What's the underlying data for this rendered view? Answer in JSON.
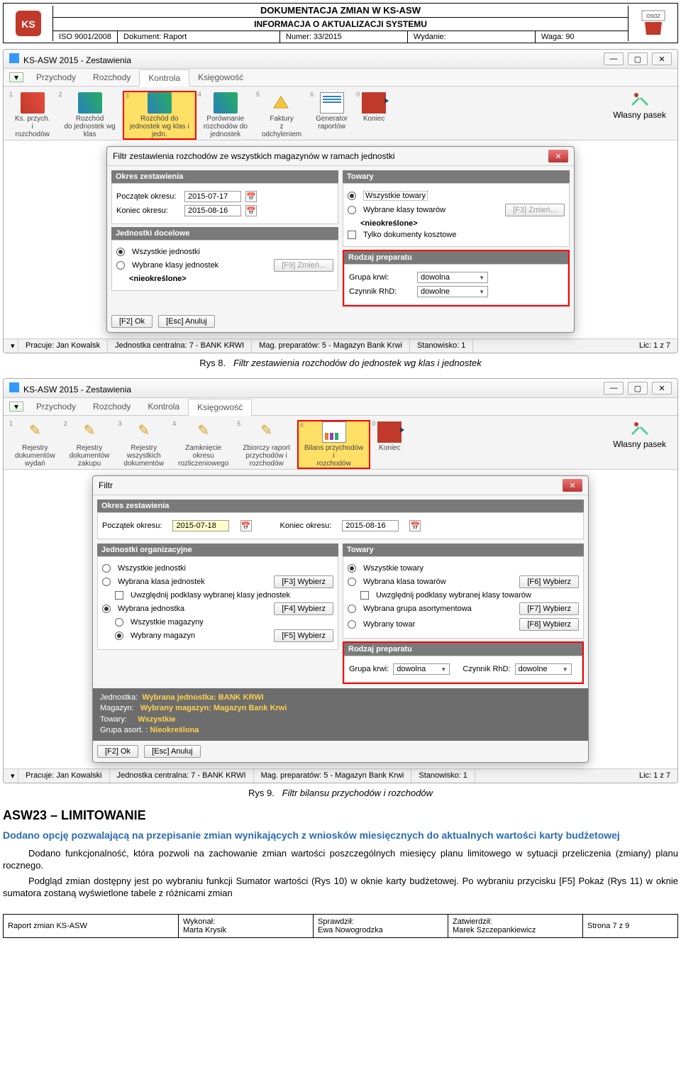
{
  "header": {
    "title": "DOKUMENTACJA ZMIAN W KS-ASW",
    "subtitle": "INFORMACJA O AKTUALIZACJI SYSTEMU",
    "iso": "ISO 9001/2008",
    "doc_label": "Dokument: Raport",
    "number": "Numer: 33/2015",
    "edition": "Wydanie:",
    "weight": "Waga: 90"
  },
  "shot1": {
    "title": "KS-ASW 2015 - Zestawienia",
    "tabs": [
      "Przychody",
      "Rozchody",
      "Kontrola",
      "Księgowość"
    ],
    "active_tab": 2,
    "ribbon": [
      {
        "n": "1",
        "label": "Ks. przych.\ni\nrozchodów"
      },
      {
        "n": "2",
        "label": "Rozchód\ndo jednostek wg\nklas"
      },
      {
        "n": "3",
        "label": "Rozchód do\njednostek wg klas i\njedn."
      },
      {
        "n": "4",
        "label": "Porównanie\nrozchodów do\njednostek"
      },
      {
        "n": "5",
        "label": "Faktury\nz\nodchyleniem"
      },
      {
        "n": "6",
        "label": "Generator\nraportów"
      },
      {
        "n": "0",
        "label": "Koniec"
      }
    ],
    "ribbon_right": "Własny pasek",
    "dialog_title": "Filtr zestawienia rozchodów ze wszystkich magazynów w ramach jednostki",
    "okres_hdr": "Okres zestawienia",
    "poczatek_lbl": "Początek okresu:",
    "poczatek_val": "2015-07-17",
    "koniec_lbl": "Koniec okresu:",
    "koniec_val": "2015-08-16",
    "jednostki_hdr": "Jednostki docelowe",
    "jedn_opt1": "Wszystkie jednostki",
    "jedn_opt2": "Wybrane klasy jednostek",
    "jedn_change": "[F9] Zmień...",
    "nieokreslone": "<nieokreślone>",
    "towary_hdr": "Towary",
    "tow_opt1": "Wszystkie towary",
    "tow_opt2": "Wybrane klasy towarów",
    "tow_change": "[F3] Zmień...",
    "tow_chk": "Tylko dokumenty kosztowe",
    "rodzaj_hdr": "Rodzaj preparatu",
    "grupa_lbl": "Grupa krwi:",
    "grupa_val": "dowolna",
    "czynnik_lbl": "Czynnik RhD:",
    "czynnik_val": "dowolne",
    "ok_btn": "[F2] Ok",
    "cancel_btn": "[Esc] Anuluj",
    "status": {
      "pracuje": "Pracuje: Jan Kowalsk",
      "jednostka": "Jednostka centralna: 7 - BANK KRWI",
      "mag": "Mag. preparatów:  5 - Magazyn Bank Krwi",
      "stan": "Stanowisko: 1",
      "lic": "Lic: 1 z 7"
    }
  },
  "caption1": {
    "label": "Rys 8.",
    "text": "Filtr zestawienia rozchodów do jednostek wg klas i jednostek"
  },
  "shot2": {
    "title": "KS-ASW 2015 - Zestawienia",
    "tabs": [
      "Przychody",
      "Rozchody",
      "Kontrola",
      "Księgowość"
    ],
    "active_tab": 3,
    "ribbon": [
      {
        "n": "1",
        "label": "Rejestry\ndokumentów\nwydań"
      },
      {
        "n": "2",
        "label": "Rejestry\ndokumentów\nzakupu"
      },
      {
        "n": "3",
        "label": "Rejestry\nwszystkich\ndokumentów"
      },
      {
        "n": "4",
        "label": "Zamknięcie\nokresu\nrozliczeniowego"
      },
      {
        "n": "5",
        "label": "Zbiorczy raport\nprzychodów i\nrozchodów"
      },
      {
        "n": "6",
        "label": "Bilans przychodów\ni\nrozchodów"
      },
      {
        "n": "0",
        "label": "Koniec"
      }
    ],
    "ribbon_right": "Własny pasek",
    "dialog_title": "Filtr",
    "okres_hdr": "Okres zestawienia",
    "poczatek_lbl": "Początek okresu:",
    "poczatek_val": "2015-07-18",
    "koniec_lbl": "Koniec okresu:",
    "koniec_val": "2015-08-16",
    "jorg_hdr": "Jednostki organizacyjne",
    "jorg_opt1": "Wszystkie jednostki",
    "jorg_opt2": "Wybrana klasa jednostek",
    "jorg_btn2": "[F3] Wybierz",
    "jorg_chk": "Uwzględnij podklasy wybranej klasy jednostek",
    "jorg_opt3": "Wybrana jednostka",
    "jorg_btn3": "[F4] Wybierz",
    "jorg_opt4": "Wszystkie magazyny",
    "jorg_opt5": "Wybrany magazyn",
    "jorg_btn5": "[F5] Wybierz",
    "towary_hdr": "Towary",
    "tow_opt1": "Wszystkie towary",
    "tow_opt2": "Wybrana klasa towarów",
    "tow_btn2": "[F6] Wybierz",
    "tow_chk": "Uwzględnij podklasy wybranej klasy towarów",
    "tow_opt3": "Wybrana grupa asortymentowa",
    "tow_btn3": "[F7] Wybierz",
    "tow_opt4": "Wybrany towar",
    "tow_btn4": "[F8] Wybierz",
    "rodzaj_hdr": "Rodzaj preparatu",
    "grupa_lbl": "Grupa krwi:",
    "grupa_val": "dowolna",
    "czynnik_lbl": "Czynnik RhD:",
    "czynnik_val": "dowolne",
    "summary": {
      "jednostka_k": "Jednostka:",
      "jednostka_v": "Wybrana jednostka: BANK KRWI",
      "magazyn_k": "Magazyn:",
      "magazyn_v": "Wybrany magazyn: Magazyn Bank Krwi",
      "towary_k": "Towary:",
      "towary_v": "Wszystkie",
      "grupa_k": "Grupa asort. :",
      "grupa_v": "Nieokreślona"
    },
    "ok_btn": "[F2] Ok",
    "cancel_btn": "[Esc] Anuluj",
    "status": {
      "pracuje": "Pracuje: Jan Kowalski",
      "jednostka": "Jednostka centralna: 7 - BANK KRWI",
      "mag": "Mag. preparatów:  5 - Magazyn Bank Krwi",
      "stan": "Stanowisko: 1",
      "lic": "Lic: 1 z 7"
    }
  },
  "caption2": {
    "label": "Rys 9.",
    "text": "Filtr bilansu przychodów i rozchodów"
  },
  "section_heading": "ASW23 – LIMITOWANIE",
  "blue_subheading": "Dodano opcję pozwalającą na przepisanie zmian wynikających z wniosków miesięcznych do aktualnych wartości karty budżetowej",
  "para1": "Dodano funkcjonalność, która pozwoli na zachowanie zmian wartości poszczególnych miesięcy planu limitowego w sytuacji przeliczenia (zmiany) planu rocznego.",
  "para2": "Podgląd zmian dostępny jest po wybraniu funkcji Sumator wartości (Rys 10) w oknie karty budżetowej. Po wybraniu przycisku [F5] Pokaż (Rys 11) w oknie sumatora zostaną wyświetlone tabele z różnicami zmian",
  "footer": {
    "c1": "Raport zmian KS-ASW",
    "c2a": "Wykonał:",
    "c2b": "Marta Krysik",
    "c3a": "Sprawdził:",
    "c3b": "Ewa Nowogrodzka",
    "c4a": "Zatwierdził:",
    "c4b": "Marek Szczepankiewicz",
    "c5": "Strona 7 z 9"
  }
}
